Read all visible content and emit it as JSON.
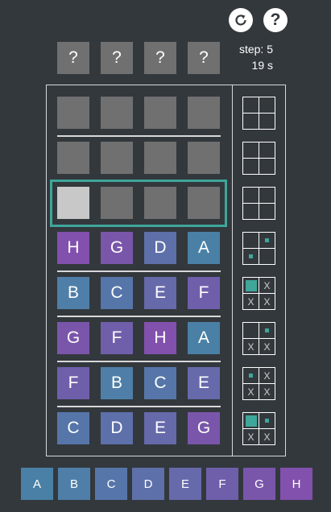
{
  "controls": {
    "restart_icon": "restart-icon",
    "help_label": "?"
  },
  "status": {
    "step_label": "step: 5",
    "time_label": "19 s"
  },
  "secret": [
    "?",
    "?",
    "?",
    "?"
  ],
  "colors": {
    "A": "#4a80a5",
    "B": "#4f7fa8",
    "C": "#5676aa",
    "D": "#5e70aa",
    "E": "#6669aa",
    "F": "#6f5fab",
    "G": "#7a56aa",
    "H": "#8250ad",
    "accent": "#3fa69a"
  },
  "guesses": [
    {
      "cells": [
        "H",
        "G",
        "D",
        "A"
      ],
      "feedback": [
        "none",
        "dot",
        "dot",
        "none"
      ]
    },
    {
      "cells": [
        "B",
        "C",
        "E",
        "F"
      ],
      "feedback": [
        "square",
        "x",
        "x",
        "x"
      ]
    },
    {
      "cells": [
        "G",
        "F",
        "H",
        "A"
      ],
      "feedback": [
        "none",
        "dot",
        "x",
        "x"
      ]
    },
    {
      "cells": [
        "F",
        "B",
        "C",
        "E"
      ],
      "feedback": [
        "dot",
        "x",
        "x",
        "x"
      ]
    },
    {
      "cells": [
        "C",
        "D",
        "E",
        "G"
      ],
      "feedback": [
        "square",
        "dot",
        "x",
        "x"
      ]
    }
  ],
  "palette": [
    "A",
    "B",
    "C",
    "D",
    "E",
    "F",
    "G",
    "H"
  ]
}
